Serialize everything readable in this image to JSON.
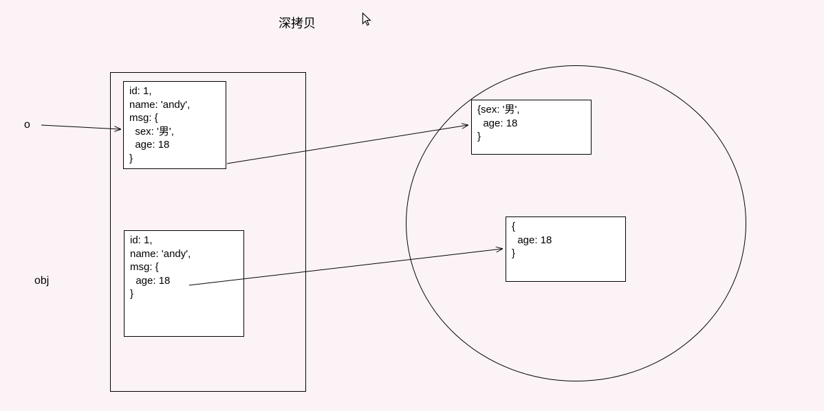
{
  "title": "深拷贝",
  "labels": {
    "o": "o",
    "obj": "obj"
  },
  "boxes": {
    "top_left": "id: 1,\nname: 'andy',\nmsg: {\n  sex: '男',\n  age: 18\n}",
    "bottom_left": "id: 1,\nname: 'andy',\nmsg: {\n  age: 18\n}",
    "top_right": "{sex: '男',\n  age: 18\n}",
    "bottom_right": "{\n  age: 18\n}"
  }
}
